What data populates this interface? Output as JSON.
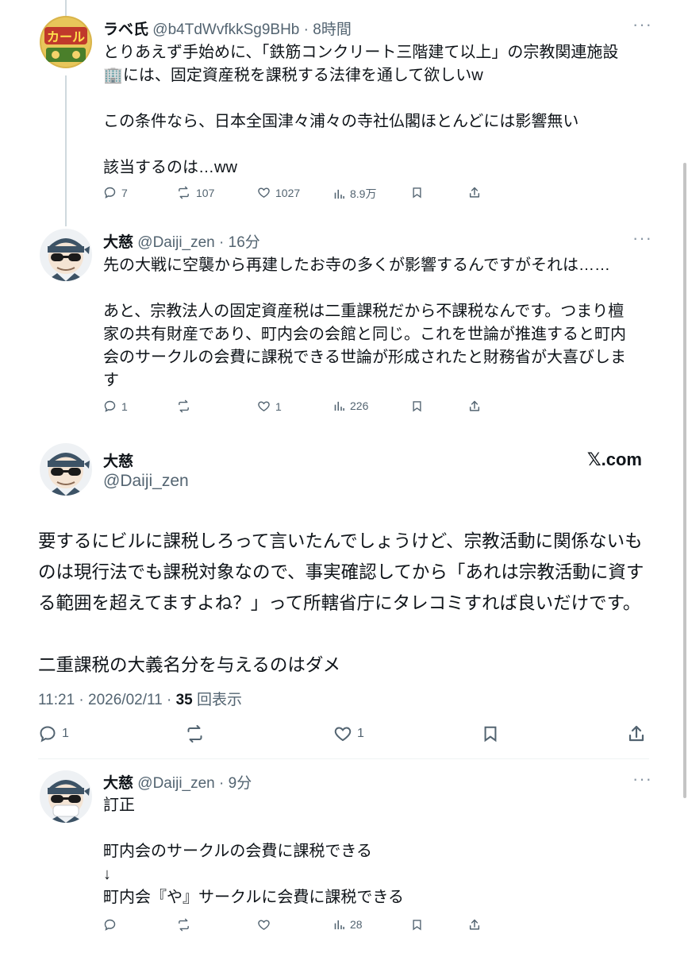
{
  "post1": {
    "name": "ラベ氏",
    "handle": "@b4TdWvfkkSg9BHb",
    "time": "8時間",
    "lines": [
      "とりあえず手始めに、「鉄筋コンクリート三階建て以上」の宗教関連施設",
      "🏢には、固定資産税を課税する法律を通して欲しいw",
      "",
      "この条件なら、日本全国津々浦々の寺社仏閣ほとんどには影響無い",
      "",
      "該当するのは…ww"
    ],
    "replies": "7",
    "reposts": "107",
    "likes": "1027",
    "views": "8.9万"
  },
  "post2": {
    "name": "大慈",
    "handle": "@Daiji_zen",
    "time": "16分",
    "lines": [
      "先の大戦に空襲から再建したお寺の多くが影響するんですがそれは……",
      "",
      "あと、宗教法人の固定資産税は二重課税だから不課税なんです。つまり檀",
      "家の共有財産であり、町内会の会館と同じ。これを世論が推進すると町内",
      "会のサークルの会費に課税できる世論が形成されたと財務省が大喜びしま",
      "す"
    ],
    "replies": "1",
    "reposts": "",
    "likes": "1",
    "views": "226"
  },
  "main": {
    "name": "大慈",
    "handle": "@Daiji_zen",
    "brand": "𝕏.com",
    "lines": [
      "要するにビルに課税しろって言いたんでしょうけど、宗教活動に関係ないも",
      "のは現行法でも課税対象なので、事実確認してから「あれは宗教活動に資す",
      "る範囲を超えてますよね？」って所轄省庁にタレコミすれば良いだけです。",
      "",
      "二重課税の大義名分を与えるのはダメ"
    ],
    "timestamp": "11:21 · 2026/02/11 · ",
    "views_count": "35",
    "views_label": "回表示",
    "replies": "1",
    "likes": "1"
  },
  "post3": {
    "name": "大慈",
    "handle": "@Daiji_zen",
    "time": "9分",
    "lines": [
      "訂正",
      "",
      "町内会のサークルの会費に課税できる",
      "↓",
      "町内会『や』サークルに会費に課税できる"
    ],
    "replies": "",
    "reposts": "",
    "likes": "",
    "views": "28"
  },
  "colors": {
    "text": "#0f1419",
    "muted": "#536471",
    "line": "#cfd9de"
  }
}
